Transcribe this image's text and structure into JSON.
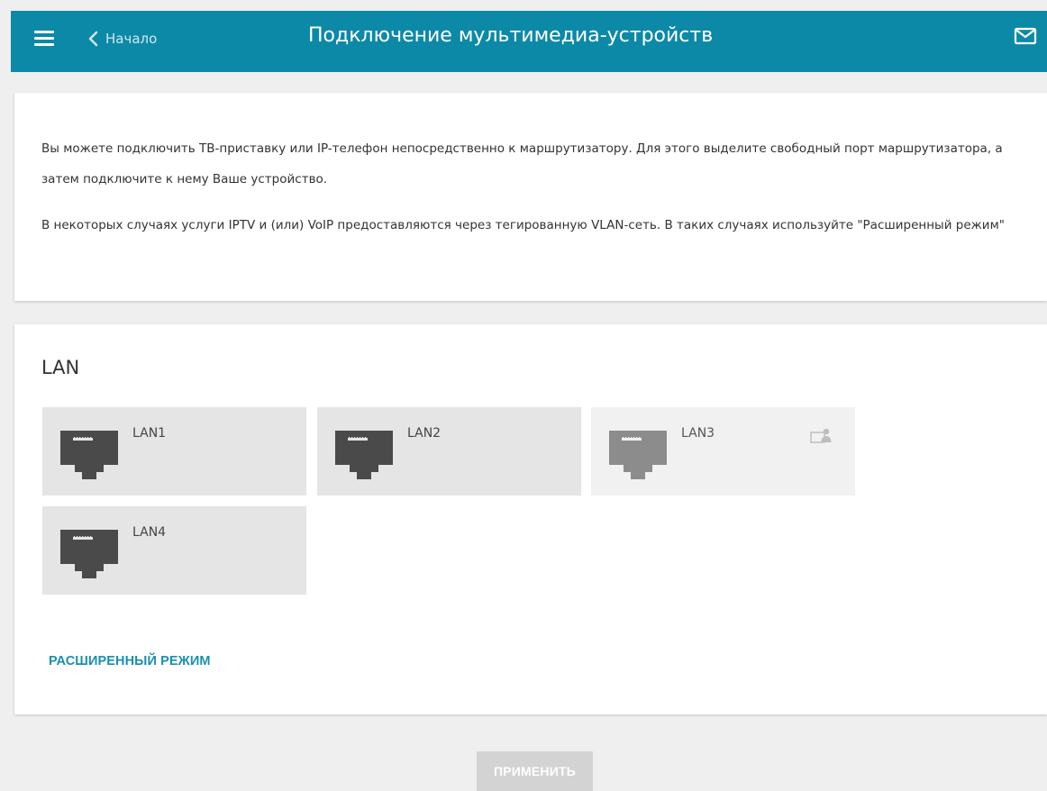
{
  "header": {
    "back_label": "Начало",
    "title": "Подключение мультимедиа-устройств",
    "menu_icon": "hamburger-menu-icon",
    "back_icon": "chevron-left-icon",
    "mail_icon": "mail-icon",
    "bg_color": "#0d89a8"
  },
  "info": {
    "paragraph1": "Вы можете подключить ТВ-приставку или IP-телефон непосредственно к маршрутизатору. Для этого выделите свободный порт маршрутизатора, а затем подключите к нему Ваше устройство.",
    "paragraph2": "В некоторых случаях услуги IPTV и (или) VoIP предоставляются через тегированную VLAN-сеть. В таких случаях используйте \"Расширенный режим\""
  },
  "lan": {
    "title": "LAN",
    "ports": [
      {
        "label": "LAN1",
        "icon": "ethernet-port-icon",
        "state": "free"
      },
      {
        "label": "LAN2",
        "icon": "ethernet-port-icon",
        "state": "free"
      },
      {
        "label": "LAN3",
        "icon": "ethernet-port-icon",
        "state": "in-use",
        "status_icon": "computer-user-icon"
      },
      {
        "label": "LAN4",
        "icon": "ethernet-port-icon",
        "state": "free"
      }
    ],
    "advanced_label": "РАСШИРЕННЫЙ РЕЖИМ"
  },
  "footer": {
    "apply_label": "ПРИМЕНИТЬ"
  },
  "colors": {
    "accent": "#0d89a8",
    "link": "#1a8fb0",
    "port_dark": "#4a4a4a",
    "port_light": "#8c8c8c",
    "apply_disabled": "#d3d3d3"
  }
}
